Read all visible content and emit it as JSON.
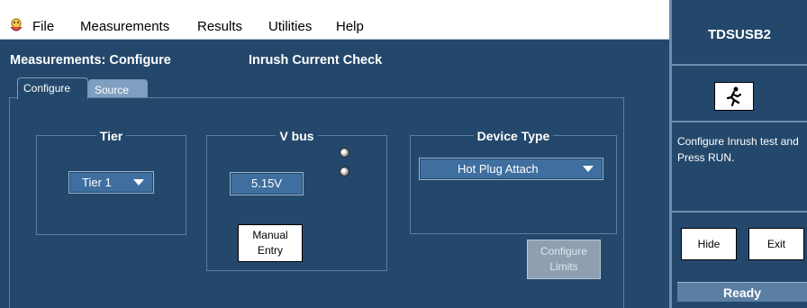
{
  "menubar": {
    "items": [
      "File",
      "Measurements",
      "Results",
      "Utilities",
      "Help"
    ]
  },
  "main": {
    "title": "Measurements: Configure",
    "subtitle": "Inrush Current Check",
    "tabs": [
      "Configure",
      "Source"
    ],
    "tier": {
      "label": "Tier",
      "value": "Tier 1"
    },
    "vbus": {
      "label": "V bus",
      "value": "5.15V",
      "manual_line1": "Manual",
      "manual_line2": "Entry"
    },
    "device_type": {
      "label": "Device Type",
      "value": "Hot Plug Attach"
    },
    "configure_limits": {
      "line1": "Configure",
      "line2": "Limits"
    }
  },
  "side": {
    "app_title": "TDSUSB2",
    "run_icon": "running-man-icon",
    "message": "Configure Inrush test and Press RUN.",
    "hide_label": "Hide",
    "exit_label": "Exit",
    "status": "Ready"
  },
  "colors": {
    "panel": "#24486b",
    "inactive_tab": "#7f9fc0",
    "disabled_button": "#8d9fb1",
    "field": "#3f6f9f"
  }
}
